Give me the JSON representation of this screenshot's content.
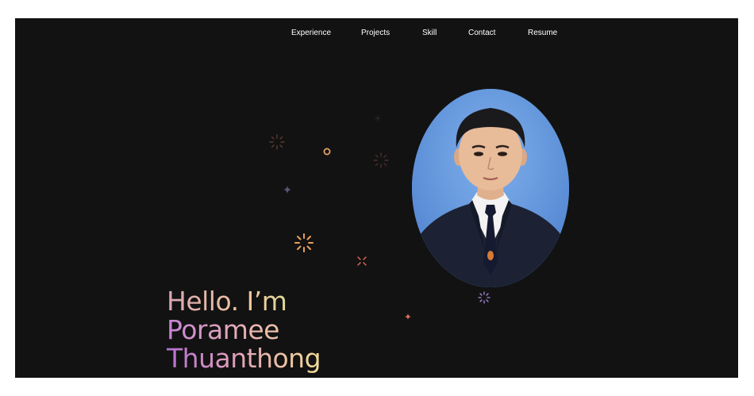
{
  "nav": {
    "items": [
      {
        "label": "Experience"
      },
      {
        "label": "Projects"
      },
      {
        "label": "Skill"
      },
      {
        "label": "Contact"
      },
      {
        "label": "Resume"
      }
    ]
  },
  "hero": {
    "line1": "Hello. I’m",
    "line2": "Poramee",
    "line3": "Thuanthong"
  },
  "colors": {
    "background": "#121212",
    "nav_text": "#ffffff",
    "gradient_purple": "#c87ad6",
    "gradient_pink": "#e8a8a8",
    "gradient_yellow": "#f2d79a",
    "gradient_green": "#c5e89a",
    "sparkle_orange": "#e9a15a",
    "sparkle_red": "#e26a5a",
    "sparkle_purple": "#a58ad9"
  },
  "icons": [
    "sparkle-icon",
    "ring-icon",
    "plus-icon",
    "burst-icon"
  ]
}
